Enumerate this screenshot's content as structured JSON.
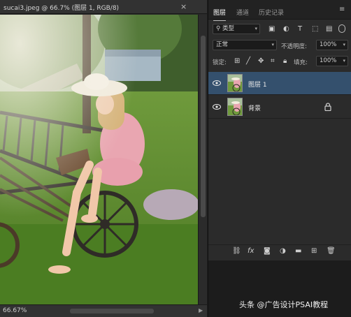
{
  "document": {
    "tab_title": "sucai3.jpeg @ 66.7% (图层 1, RGB/8)",
    "close_glyph": "×",
    "zoom_status": "66.67%"
  },
  "panel": {
    "tabs": [
      {
        "label": "图层",
        "active": true
      },
      {
        "label": "通道",
        "active": false
      },
      {
        "label": "历史记录",
        "active": false
      }
    ],
    "filter": {
      "kind_label": "类型"
    },
    "blend_mode": "正常",
    "opacity_label": "不透明度:",
    "opacity_value": "100%",
    "lock_label": "锁定:",
    "fill_label": "填充:",
    "fill_value": "100%",
    "layers": [
      {
        "name": "图层 1",
        "selected": true,
        "visible": true,
        "locked": false
      },
      {
        "name": "背景",
        "selected": false,
        "visible": true,
        "locked": true
      }
    ],
    "footer_icons": [
      "link-icon",
      "fx-icon",
      "mask-icon",
      "adjustment-icon",
      "folder-icon",
      "new-layer-icon",
      "trash-icon"
    ]
  },
  "watermark": "头条 @广告设计PSAI教程",
  "colors": {
    "selection": "#34506d",
    "panel_bg": "#2b2b2b",
    "app_bg": "#1e1e1e"
  }
}
